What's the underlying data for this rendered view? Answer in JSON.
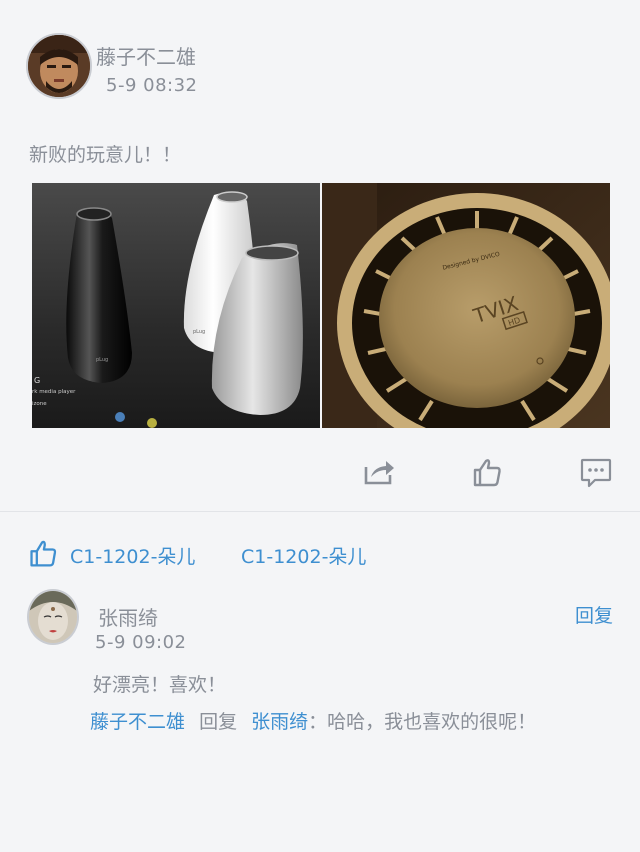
{
  "post": {
    "author": "藤子不二雄",
    "time": "5-9 08:32",
    "text": "新败的玩意儿！！",
    "images": [
      {
        "name": "black-white-speaker-product-photo",
        "texts": [
          "G",
          "rk media player",
          "izone",
          "pLug",
          "pLug"
        ]
      },
      {
        "name": "gold-tvix-hd-media-player-photo",
        "texts": [
          "Designed by DVICO",
          "TVIX",
          "HD"
        ]
      }
    ]
  },
  "actions": {
    "share_icon": "share-icon",
    "like_icon": "thumbs-up-icon",
    "comment_icon": "comment-bubble-icon"
  },
  "likes": {
    "icon": "thumbs-up-icon",
    "users": [
      "C1-1202-朵儿",
      "C1-1202-朵儿"
    ]
  },
  "comments": [
    {
      "name": "张雨绮",
      "time": "5-9 09:02",
      "reply_label": "回复",
      "text": "好漂亮！喜欢！",
      "replies": [
        {
          "from": "藤子不二雄",
          "verb": "回复",
          "to": "张雨绮",
          "text": "：哈哈，我也喜欢的很呢！"
        }
      ]
    }
  ],
  "colors": {
    "background": "#f4f5f7",
    "link_blue": "#3e8fd0",
    "muted_text": "#8a8f98",
    "divider": "#e2e4e8"
  }
}
